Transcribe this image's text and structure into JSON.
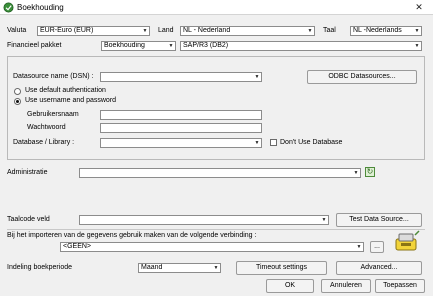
{
  "window": {
    "title": "Boekhouding",
    "close_glyph": "✕"
  },
  "top_row": {
    "valuta_label": "Valuta",
    "valuta_value": "EUR-Euro (EUR)",
    "land_label": "Land",
    "land_value": "NL - Nederland",
    "taal_label": "Taal",
    "taal_value": "NL -Nederlands"
  },
  "pakket": {
    "label": "Financieel pakket",
    "value": "Boekhouding",
    "version_value": "SAP/R3 (DB2)"
  },
  "datasource": {
    "dsn_label": "Datasource name (DSN) :",
    "dsn_value": "",
    "odbc_button": "ODBC Datasources...",
    "radio_default": "Use default authentication",
    "radio_userpass": "Use username and password",
    "username_label": "Gebruikersnaam",
    "password_label": "Wachtwoord",
    "database_label": "Database / Library :",
    "database_value": "",
    "dont_use_db_label": "Don't Use Database"
  },
  "administratie": {
    "label": "Administratie",
    "value": ""
  },
  "taalcode": {
    "label": "Taalcode veld",
    "value": "",
    "test_button": "Test Data Source..."
  },
  "connection": {
    "label": "Bij het importeren van de gegevens gebruik maken van de volgende verbinding :",
    "value": "<GEEN>",
    "browse_button": "..."
  },
  "indeling": {
    "label": "Indeling boekperiode",
    "value": "Maand",
    "timeout_button": "Timeout settings",
    "advanced_button": "Advanced..."
  },
  "footer": {
    "ok": "OK",
    "cancel": "Annuleren",
    "apply": "Toepassen"
  },
  "icons": {
    "arrow_glyph": "▼",
    "refresh_glyph": "↻"
  },
  "colors": {
    "field_bg": "#ffffff",
    "dialog_bg": "#f0f0f0",
    "icon_green": "#4d8a3a",
    "icon_yellow": "#f2d43a"
  }
}
